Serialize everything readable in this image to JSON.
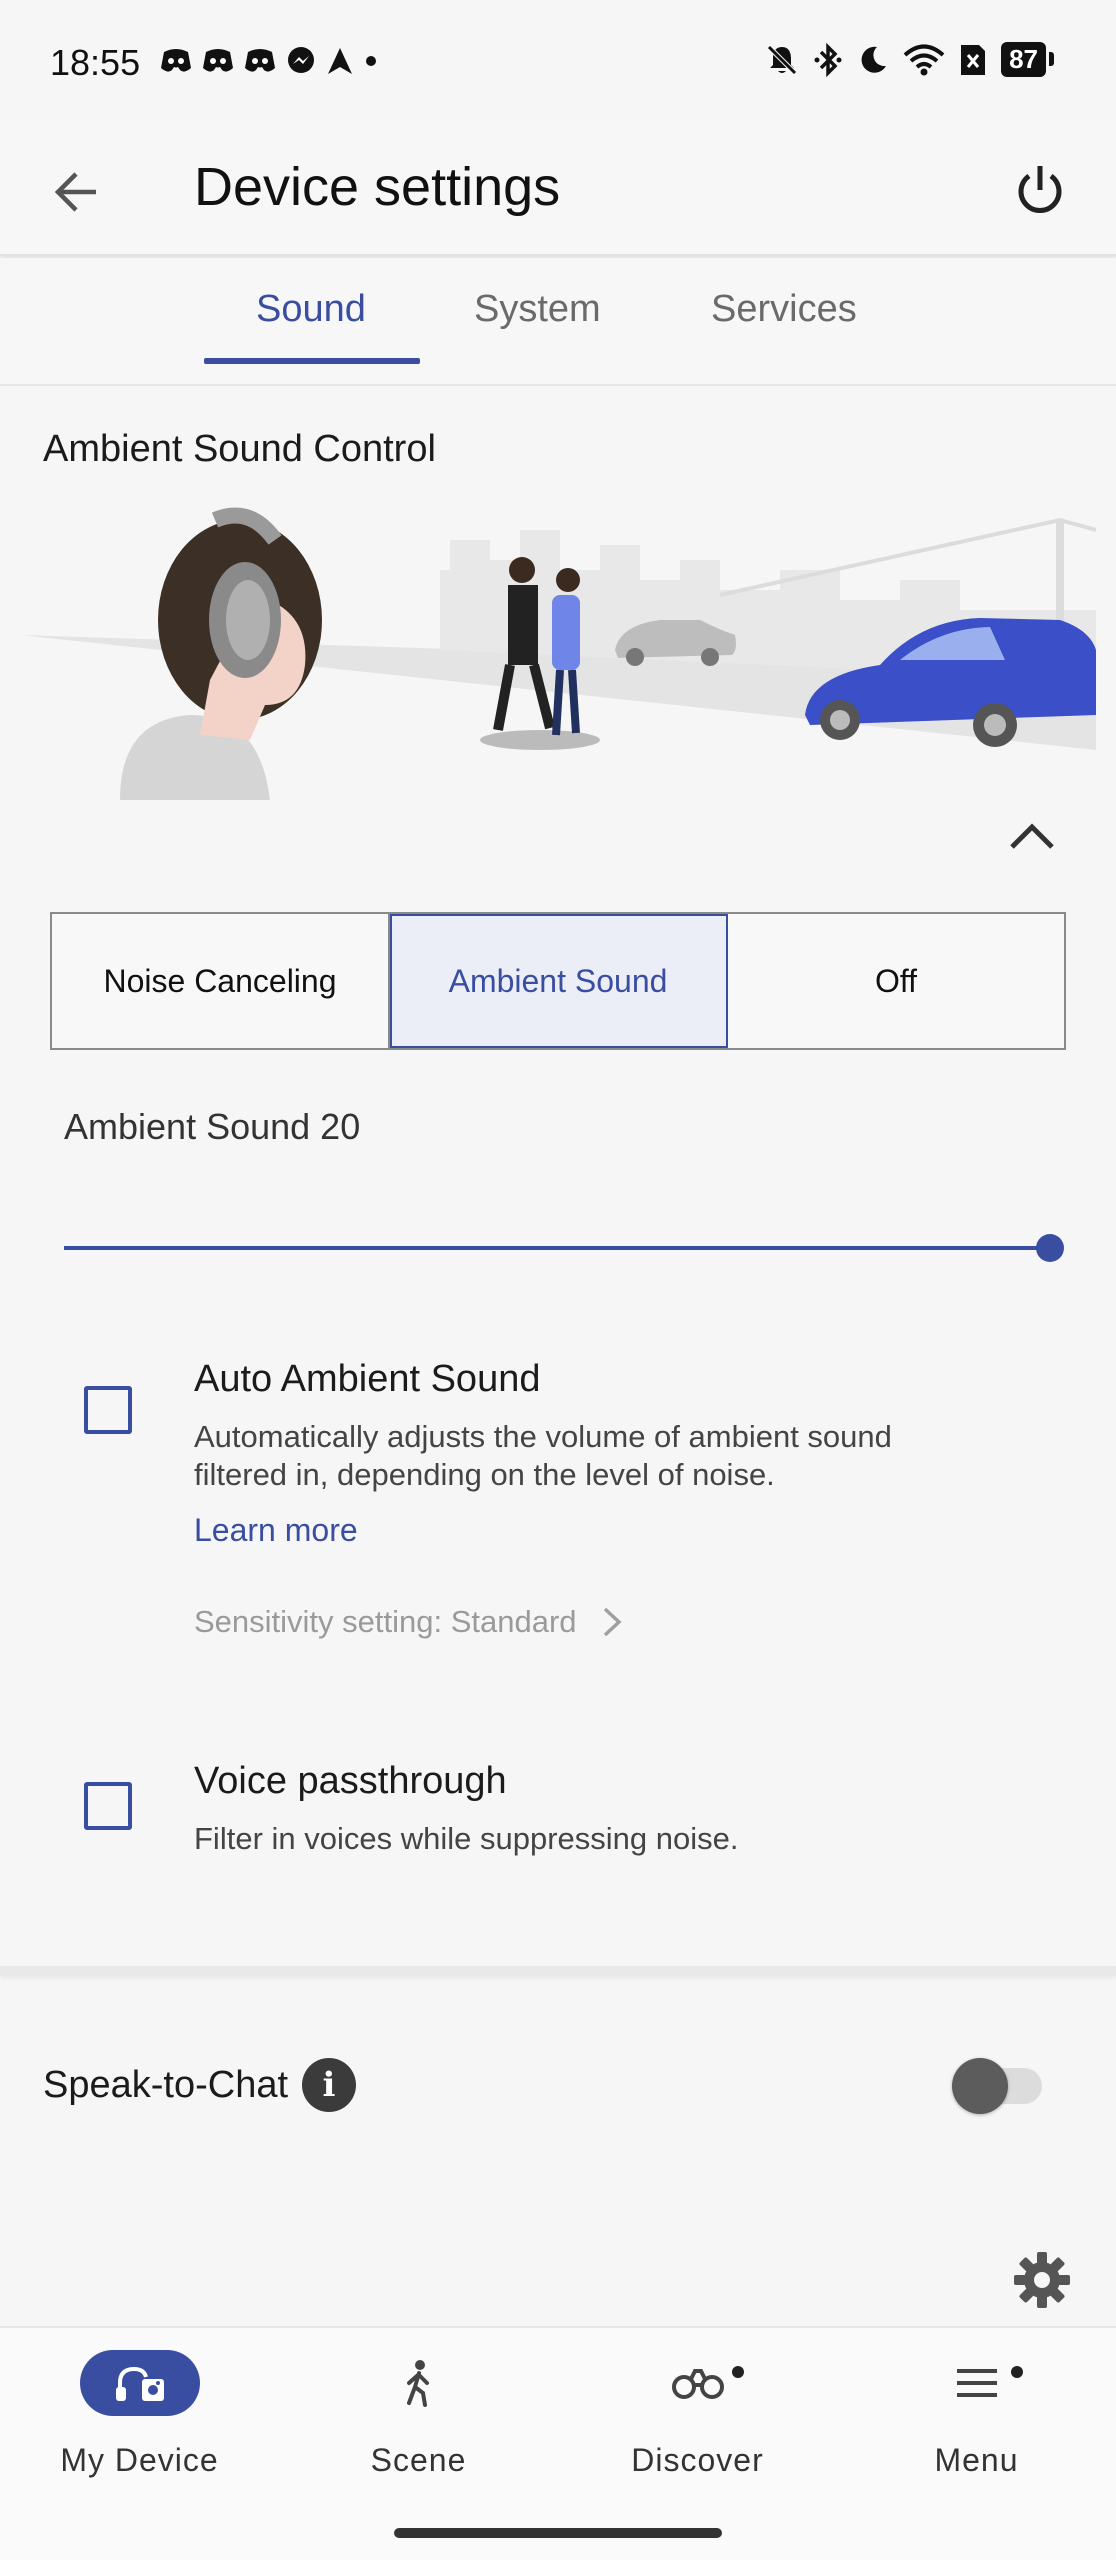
{
  "status": {
    "time": "18:55",
    "battery": "87",
    "notif_icons": [
      "discord-icon",
      "discord-icon",
      "discord-icon",
      "messenger-icon",
      "navigation-icon",
      "dot-icon"
    ]
  },
  "appbar": {
    "title": "Device settings"
  },
  "tabs": [
    {
      "label": "Sound",
      "active": true
    },
    {
      "label": "System",
      "active": false
    },
    {
      "label": "Services",
      "active": false
    }
  ],
  "ambient_control": {
    "section_title": "Ambient Sound Control",
    "modes": [
      {
        "label": "Noise Canceling",
        "active": false
      },
      {
        "label": "Ambient Sound",
        "active": true
      },
      {
        "label": "Off",
        "active": false
      }
    ],
    "level_label": "Ambient Sound 20",
    "level_fraction": 1.0
  },
  "auto_ambient": {
    "title": "Auto Ambient Sound",
    "desc_line1": "Automatically adjusts the volume of ambient sound",
    "desc_line2": "filtered in, depending on the level of noise.",
    "learn_more": "Learn more",
    "sensitivity": "Sensitivity setting: Standard",
    "checked": false
  },
  "voice_passthrough": {
    "title": "Voice passthrough",
    "desc": "Filter in voices while suppressing noise.",
    "checked": false
  },
  "speak_to_chat": {
    "label": "Speak-to-Chat",
    "enabled": false
  },
  "bottom_nav": [
    {
      "label": "My Device",
      "icon": "headphones-device-icon",
      "active": true
    },
    {
      "label": "Scene",
      "icon": "walking-person-icon",
      "active": false
    },
    {
      "label": "Discover",
      "icon": "binoculars-icon",
      "active": false
    },
    {
      "label": "Menu",
      "icon": "hamburger-menu-icon",
      "active": false
    }
  ],
  "colors": {
    "accent": "#3a4ea1",
    "background": "#f6f6f6"
  }
}
